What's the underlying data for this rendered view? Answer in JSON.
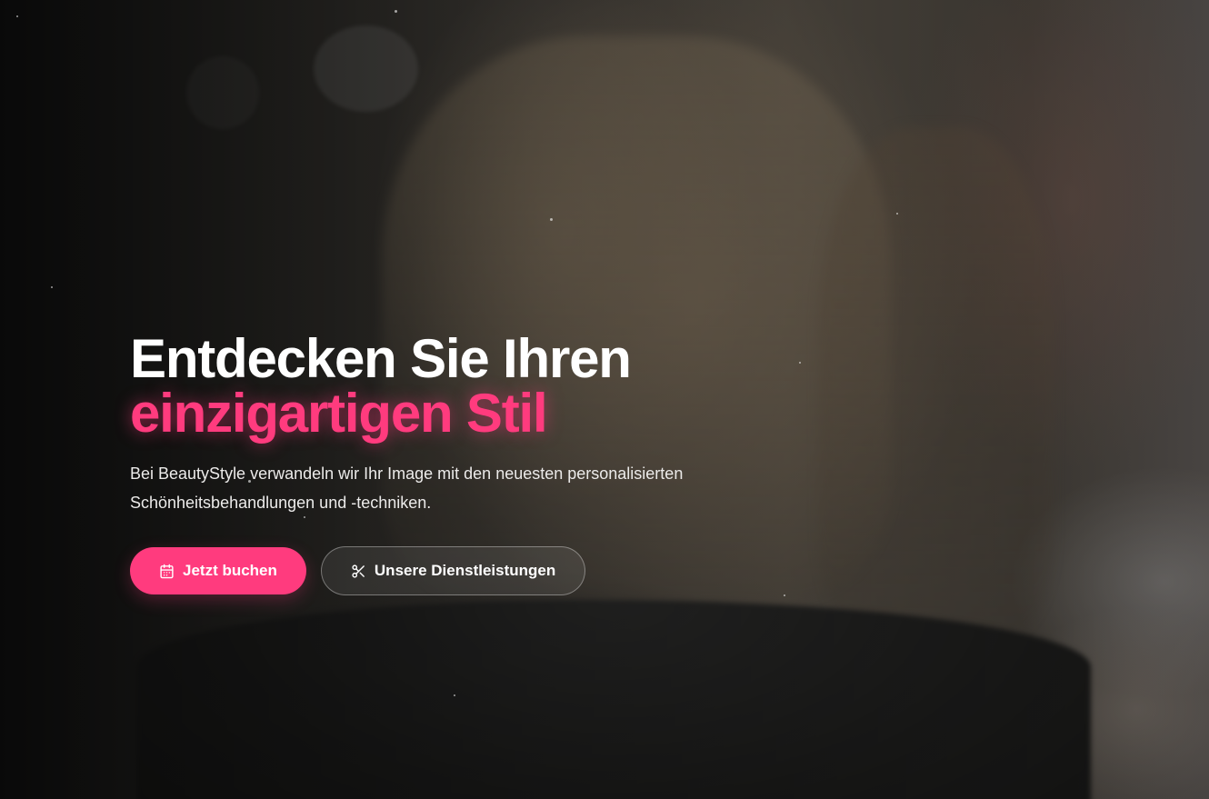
{
  "hero": {
    "headline_line1": "Entdecken Sie Ihren",
    "headline_line2": "einzigartigen Stil",
    "subtitle": "Bei BeautyStyle verwandeln wir Ihr Image mit den neuesten personalisierten Schönheitsbehandlungen und -techniken.",
    "primary_button": {
      "label": "Jetzt buchen",
      "icon": "calendar-icon"
    },
    "secondary_button": {
      "label": "Unsere Dienstleistungen",
      "icon": "scissors-icon"
    }
  },
  "colors": {
    "accent": "#ff3b7e",
    "text": "#ffffff",
    "subtitle_text": "#ecebea"
  }
}
